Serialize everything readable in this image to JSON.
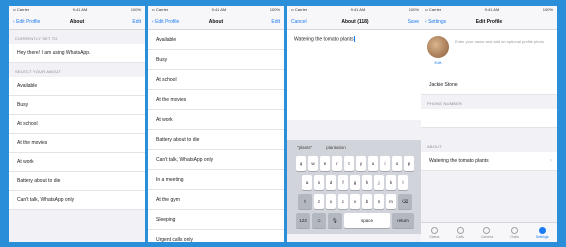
{
  "screens": {
    "about": {
      "status_left": "•• Carrier",
      "status_center": "9:41 AM",
      "status_right": "100%",
      "back_label": "Edit Profile",
      "title": "About",
      "right_label": "Edit",
      "current_header": "Currently set to",
      "current_value": "Hey there! I am using WhatsApp.",
      "select_header": "Select your About",
      "items": [
        "Available",
        "Busy",
        "At school",
        "At the movies",
        "At work",
        "Battery about to die",
        "Can't talk, WhatsApp only"
      ]
    },
    "about_list": {
      "status_left": "•• Carrier",
      "status_center": "9:41 AM",
      "status_right": "100%",
      "back_label": "Edit Profile",
      "title": "About",
      "right_label": "Edit",
      "items": [
        "Available",
        "Busy",
        "At school",
        "At the movies",
        "At work",
        "Battery about to die",
        "Can't talk, WhatsApp only",
        "In a meeting",
        "At the gym",
        "Sleeping",
        "Urgent calls only"
      ]
    },
    "edit_about": {
      "status_left": "•• Carrier",
      "status_center": "9:41 AM",
      "status_right": "100%",
      "cancel_label": "Cancel",
      "title": "About (118)",
      "save_label": "Save",
      "text_value": "Watering the tomato plants",
      "suggestions": [
        "\"plants\"",
        "plantation"
      ],
      "keys_row1": [
        "q",
        "w",
        "e",
        "r",
        "t",
        "y",
        "u",
        "i",
        "o",
        "p"
      ],
      "keys_row2": [
        "a",
        "s",
        "d",
        "f",
        "g",
        "h",
        "j",
        "k",
        "l"
      ],
      "keys_row3": [
        "z",
        "x",
        "c",
        "v",
        "b",
        "n",
        "m"
      ],
      "key_shift": "⇧",
      "key_delete": "⌫",
      "key_numbers": "123",
      "key_emoji": "☺",
      "key_mic": "🎙",
      "key_space": "space",
      "key_return": "return"
    },
    "edit_profile": {
      "status_left": "•• Carrier",
      "status_center": "9:41 AM",
      "status_right": "100%",
      "back_label": "Settings",
      "title": "Edit Profile",
      "edit_link": "Edit",
      "hint": "Enter your name and add an optional profile photo",
      "name_value": "Jackie Stone",
      "phone_header": "Phone number",
      "phone_value": "",
      "about_header": "About",
      "about_value": "Watering the tomato plants",
      "tabs": [
        "Status",
        "Calls",
        "Camera",
        "Chats",
        "Settings"
      ]
    }
  }
}
